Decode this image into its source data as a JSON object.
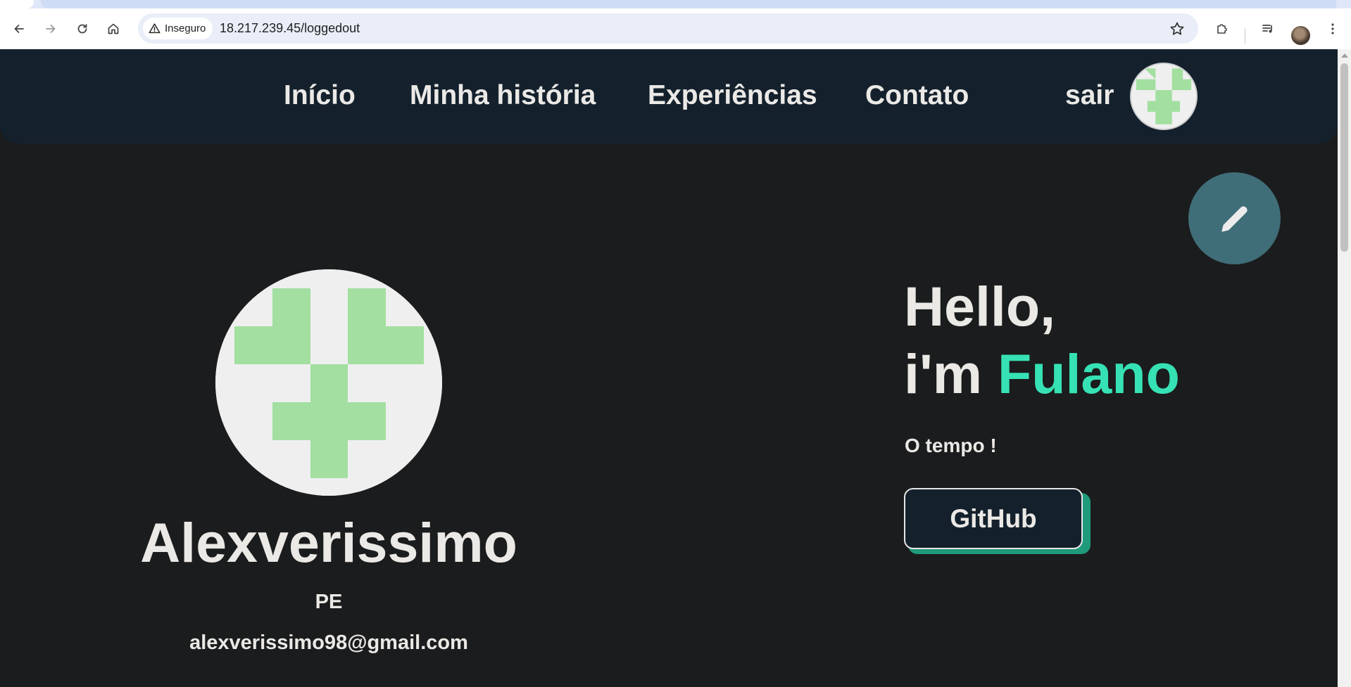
{
  "browser": {
    "security_label": "Inseguro",
    "url": "18.217.239.45/loggedout"
  },
  "nav": {
    "items": [
      "Início",
      "Minha história",
      "Experiências",
      "Contato"
    ],
    "logout_label": "sair"
  },
  "profile": {
    "name": "Alexverissimo",
    "state": "PE",
    "email": "alexverissimo98@gmail.com"
  },
  "intro": {
    "greeting": "Hello,",
    "im_prefix": "i'm ",
    "highlight_name": "Fulano",
    "tagline": "O tempo !",
    "github_label": "GitHub"
  },
  "colors": {
    "navbar": "#14212d",
    "page_bg": "#1b1c1d",
    "accent": "#36e2b4",
    "fab": "#3f6d78",
    "button_shadow": "#1f9a7a",
    "identicon": "#a2dfa0"
  },
  "icons": {
    "back": "arrow-left-icon",
    "forward": "arrow-right-icon",
    "reload": "reload-icon",
    "home": "home-icon",
    "warning": "warning-icon",
    "bookmark": "star-icon",
    "extensions": "puzzle-icon",
    "media": "media-queue-icon",
    "menu": "kebab-menu-icon",
    "edit": "pencil-icon"
  }
}
